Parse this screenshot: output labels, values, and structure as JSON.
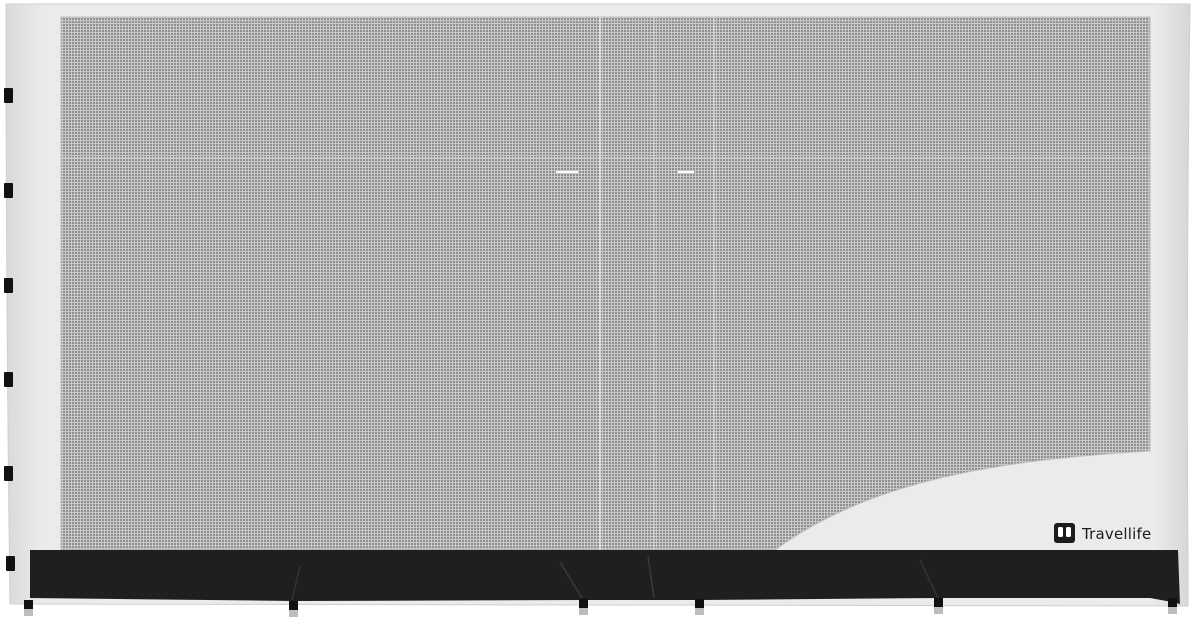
{
  "brand": {
    "name": "Travellife",
    "logo_icon": "travellife-logo-icon"
  },
  "colors": {
    "fabric": "#e6e6e6",
    "mesh": "#a9a9a9",
    "skirt": "#1f1f1f",
    "logo": "#1c1c1c"
  }
}
